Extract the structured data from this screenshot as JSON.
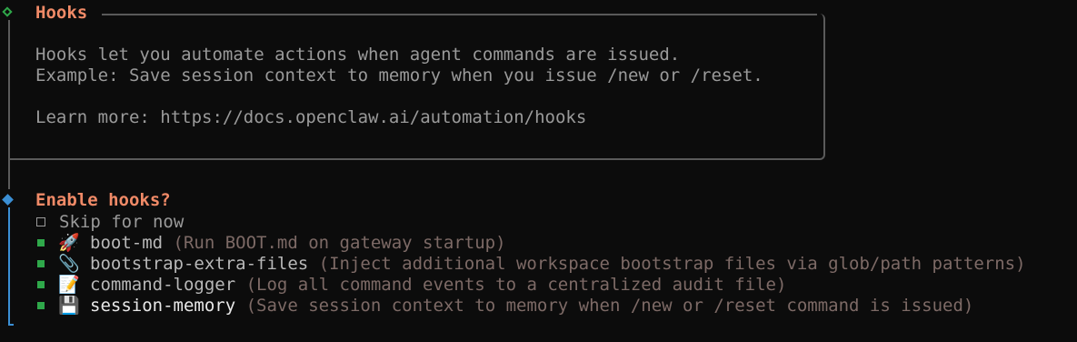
{
  "hooks_panel": {
    "title": "Hooks",
    "line1": "Hooks let you automate actions when agent commands are issued.",
    "line2": "Example: Save session context to memory when you issue /new or /reset.",
    "learn_more": "Learn more: https://docs.openclaw.ai/automation/hooks"
  },
  "prompt": {
    "question": "Enable hooks?",
    "skip_label": "Skip for now",
    "options": [
      {
        "emoji": "🚀",
        "emoji_icon": "rocket-icon",
        "name": "boot-md",
        "desc": " (Run BOOT.md on gateway startup)",
        "checked": true
      },
      {
        "emoji": "📎",
        "emoji_icon": "paperclip-icon",
        "name": "bootstrap-extra-files",
        "desc": " (Inject additional workspace bootstrap files via glob/path patterns)",
        "checked": true
      },
      {
        "emoji": "📝",
        "emoji_icon": "memo-icon",
        "name": "command-logger",
        "desc": " (Log all command events to a centralized audit file)",
        "checked": true
      },
      {
        "emoji": "💾",
        "emoji_icon": "floppy-disk-icon",
        "name": "session-memory",
        "desc": " (Save session context to memory when /new or /reset command is issued)",
        "checked": true
      }
    ]
  },
  "colors": {
    "accent_title": "#f08a67",
    "check_green": "#2fa84a",
    "cursor_blue": "#3b8fd4"
  }
}
